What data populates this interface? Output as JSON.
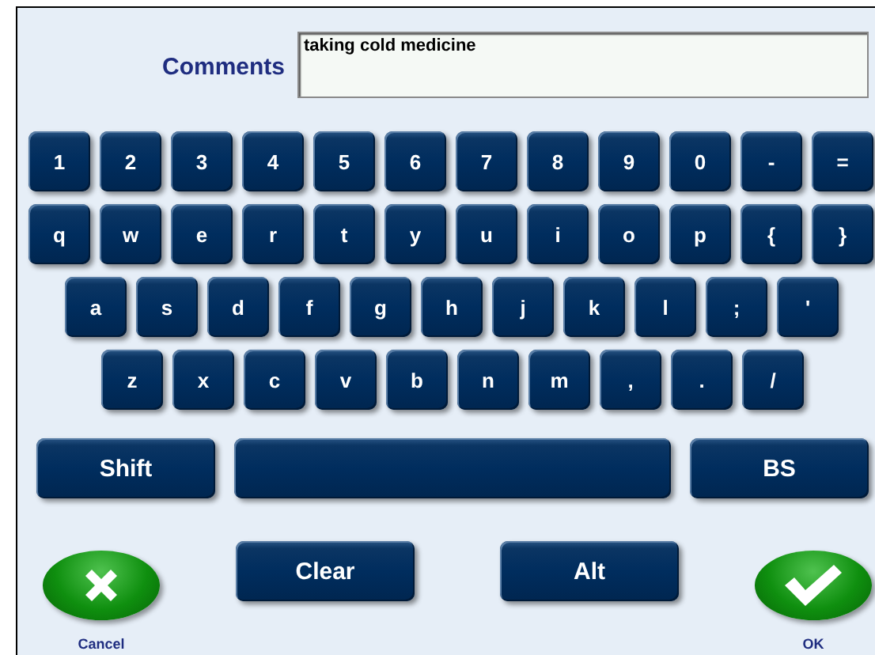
{
  "comments": {
    "label": "Comments",
    "value": "taking cold medicine"
  },
  "key_rows": [
    [
      "1",
      "2",
      "3",
      "4",
      "5",
      "6",
      "7",
      "8",
      "9",
      "0",
      "-",
      "="
    ],
    [
      "q",
      "w",
      "e",
      "r",
      "t",
      "y",
      "u",
      "i",
      "o",
      "p",
      "{",
      "}"
    ],
    [
      "a",
      "s",
      "d",
      "f",
      "g",
      "h",
      "j",
      "k",
      "l",
      ";",
      "'"
    ],
    [
      "z",
      "x",
      "c",
      "v",
      "b",
      "n",
      "m",
      ",",
      ".",
      "/"
    ]
  ],
  "bottom_keys": [
    {
      "kind": "shift",
      "label": "Shift"
    },
    {
      "kind": "space"
    },
    {
      "kind": "backspace",
      "label": "BS"
    }
  ],
  "actions": [
    {
      "kind": "cancel",
      "label": "Cancel"
    },
    {
      "kind": "button",
      "label": "Clear"
    },
    {
      "kind": "button",
      "label": "Alt"
    },
    {
      "kind": "ok",
      "label": "OK"
    }
  ]
}
